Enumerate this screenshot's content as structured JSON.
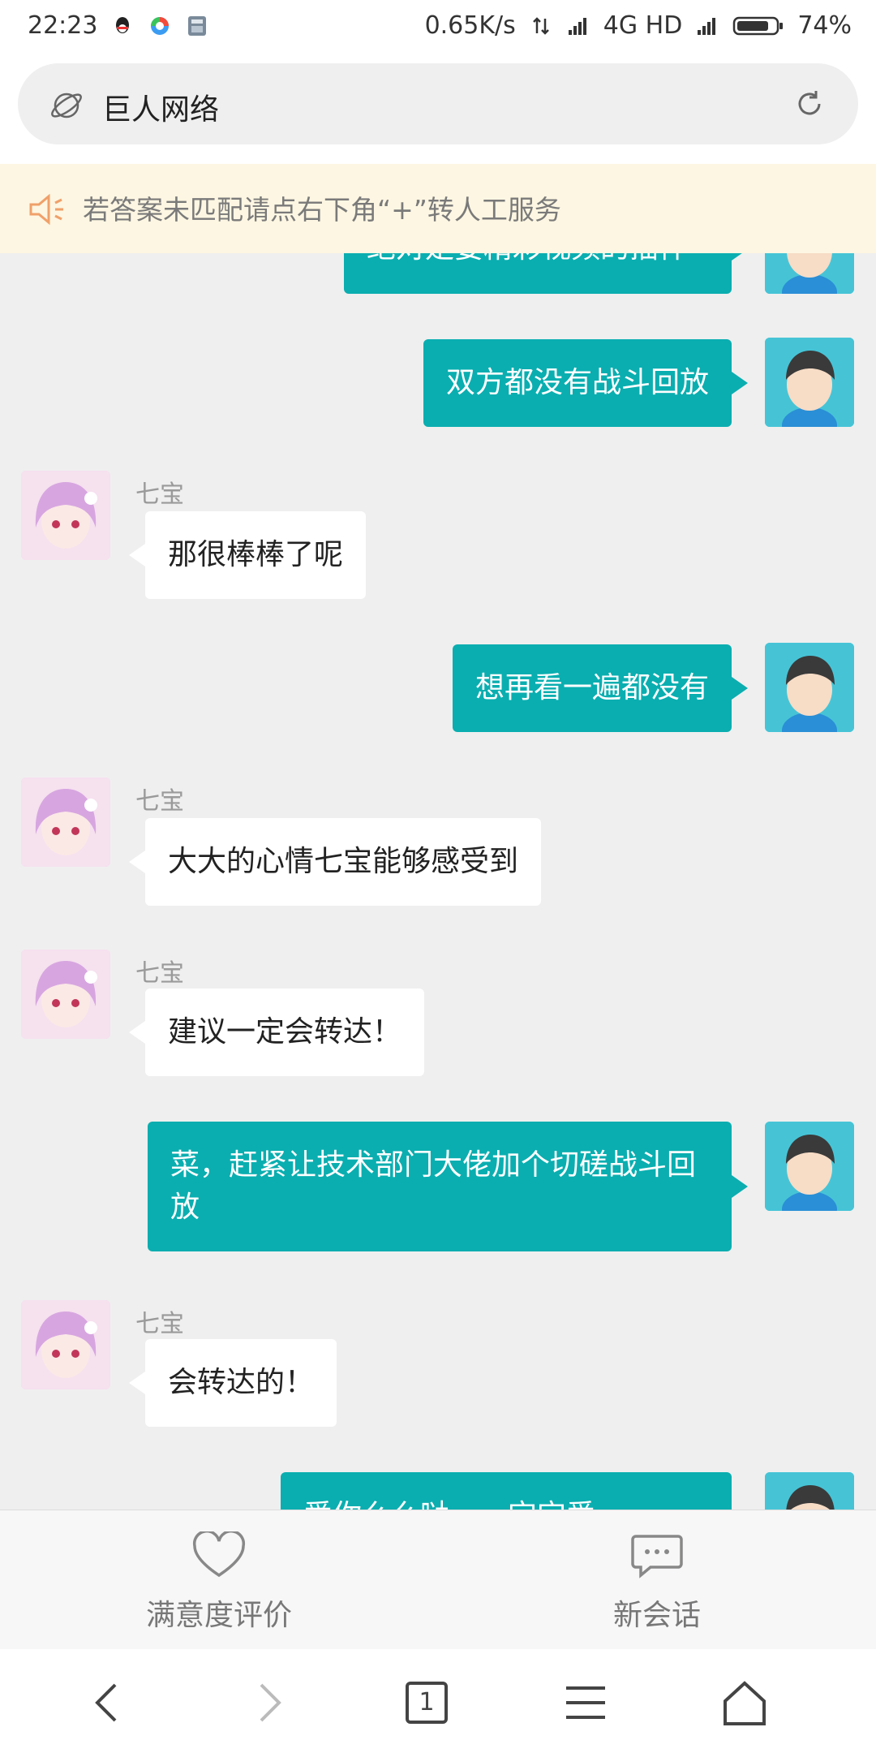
{
  "status": {
    "time": "22:23",
    "net_speed": "0.65K/s",
    "network": "4G HD",
    "battery": "74%"
  },
  "header": {
    "title": "巨人网络"
  },
  "notice": {
    "text": "若答案未匹配请点右下角“+”转人工服务"
  },
  "agent_name": "七宝",
  "messages": [
    {
      "side": "right",
      "text": "绝对是要精彩视频的插件"
    },
    {
      "side": "right",
      "text": "双方都没有战斗回放"
    },
    {
      "side": "left",
      "text": "那很棒棒了呢"
    },
    {
      "side": "right",
      "text": "想再看一遍都没有"
    },
    {
      "side": "left",
      "text": "大大的心情七宝能够感受到"
    },
    {
      "side": "left",
      "text": "建议一定会转达！"
    },
    {
      "side": "right",
      "text": "菜，赶紧让技术部门大佬加个切磋战斗回放"
    },
    {
      "side": "left",
      "text": "会转达的！"
    },
    {
      "side": "right",
      "text": "爱你么么哒……宝宝爱你！！！"
    }
  ],
  "actions": {
    "rate": "满意度评价",
    "new_chat": "新会话"
  },
  "browser": {
    "tab_count": "1"
  },
  "colors": {
    "accent": "#0aaeb0",
    "background": "#efefef",
    "notice_bg": "#fdf6e2"
  }
}
